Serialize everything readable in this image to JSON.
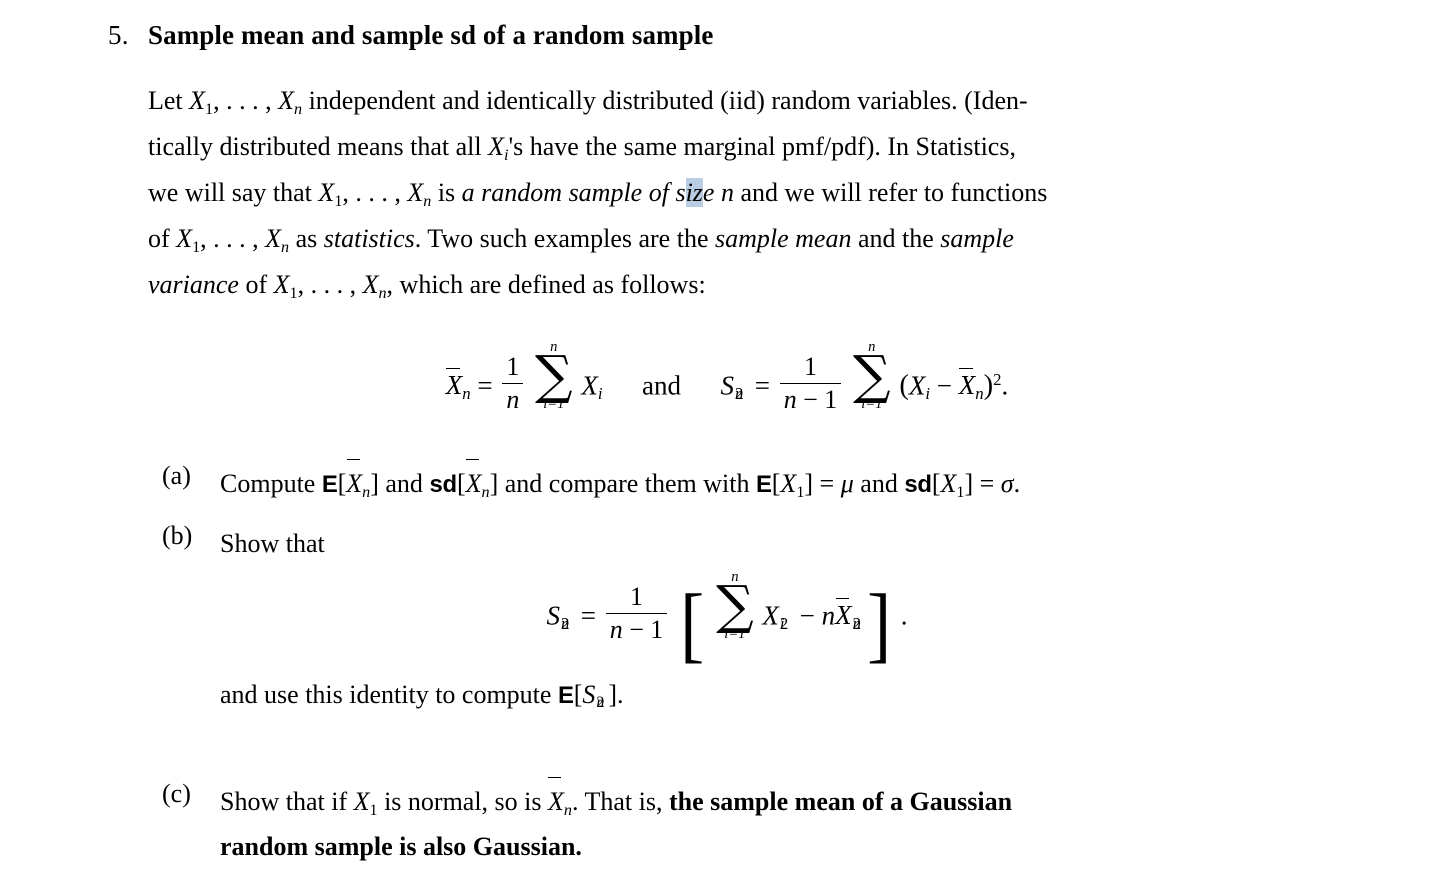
{
  "document": {
    "item_number": "5.",
    "title": "Sample mean and sample sd of a random sample",
    "paragraph": {
      "line1_a": "Let ",
      "line1_b": "X",
      "line1_c": "1",
      "line1_d": ", . . . , ",
      "line1_e": "X",
      "line1_f": "n",
      "line1_g": " independent and identically distributed (iid) random variables. (Iden-",
      "line2_a": "tically distributed means that all ",
      "line2_b": "X",
      "line2_c": "i",
      "line2_d": "'s have the same marginal pmf/pdf). In Statistics,",
      "line3_a": "we will say that ",
      "line3_b": "X",
      "line3_c": "1",
      "line3_d": ", . . . , ",
      "line3_e": "X",
      "line3_f": "n",
      "line3_g": " is ",
      "line3_h": "a random sample of s",
      "line3_highlight": "iz",
      "line3_i": "e ",
      "line3_j": "n",
      "line3_k": " and we will refer to functions",
      "line4_a": "of ",
      "line4_b": "X",
      "line4_c": "1",
      "line4_d": ", . . . , ",
      "line4_e": "X",
      "line4_f": "n",
      "line4_g": " as ",
      "line4_h": "statistics",
      "line4_i": ". Two such examples are the ",
      "line4_j": "sample mean",
      "line4_k": " and the ",
      "line4_l": "sample",
      "line5_a": "variance",
      "line5_b": " of ",
      "line5_c": "X",
      "line5_d": "1",
      "line5_e": ", . . . , ",
      "line5_f": "X",
      "line5_g": "n",
      "line5_h": ", which are defined as follows:"
    },
    "equation_main": {
      "lhs_var": "X",
      "lhs_sub": "n",
      "equals": "=",
      "frac1_num": "1",
      "frac1_den": "n",
      "sigma": "∑",
      "sum_top": "n",
      "sum_bot": "i=1",
      "summand_var": "X",
      "summand_sub": "i",
      "conjunction": "and",
      "rhs_var": "S",
      "rhs_sup": "2",
      "rhs_sub": "n",
      "frac2_num": "1",
      "frac2_den_n": "n",
      "frac2_den_minus": "−",
      "frac2_den_one": "1",
      "paren_open": "(",
      "term1_var": "X",
      "term1_sub": "i",
      "minus": "−",
      "term2_var": "X",
      "term2_sub": "n",
      "paren_close": ")",
      "power": "2",
      "period": "."
    },
    "parts": [
      {
        "label": "(a)",
        "text_a": "Compute ",
        "op1": "E",
        "b1_open": "[",
        "b1_var": "X",
        "b1_sub": "n",
        "b1_close": "]",
        "text_b": " and ",
        "op2": "sd",
        "b2_open": "[",
        "b2_var": "X",
        "b2_sub": "n",
        "b2_close": "]",
        "text_c": " and compare them with ",
        "op3": "E",
        "b3_open": "[",
        "b3_var": "X",
        "b3_sub": "1",
        "b3_close": "]",
        "eq1": " = ",
        "mu": "μ",
        "text_d": " and ",
        "op4": "sd",
        "b4_open": "[",
        "b4_var": "X",
        "b4_sub": "1",
        "b4_close": "]",
        "eq2": " = ",
        "sigma_sym": "σ",
        "period": "."
      },
      {
        "label": "(b)",
        "text_a": "Show that",
        "closing_a": "and use this identity to compute ",
        "closing_op": "E",
        "closing_open": "[",
        "closing_var": "S",
        "closing_sup": "2",
        "closing_sub": "n",
        "closing_close": "]",
        "closing_period": "."
      },
      {
        "label": "(c)",
        "text_a": "Show that if ",
        "var1": "X",
        "var1_sub": "1",
        "text_b": " is normal, so is ",
        "var2": "X",
        "var2_sub": "n",
        "text_c": ". That is,  ",
        "bold_line1": "the sample mean of a Gaussian",
        "bold_line2": "random sample is also Gaussian."
      }
    ],
    "equation_b": {
      "lhs_var": "S",
      "lhs_sup": "2",
      "lhs_sub": "n",
      "equals": "=",
      "frac_num": "1",
      "frac_den_n": "n",
      "frac_den_minus": "−",
      "frac_den_one": "1",
      "bracket_open": "[",
      "sigma": "∑",
      "sum_top": "n",
      "sum_bot": "i=1",
      "term1_var": "X",
      "term1_sub": "i",
      "term1_sup": "2",
      "minus": "−",
      "coef": "n",
      "term2_var": "X",
      "term2_sub": "n",
      "term2_sup": "2",
      "bracket_close": "]",
      "period": "."
    }
  },
  "colors": {
    "text": "#000000",
    "background": "#ffffff",
    "selection_highlight": "#b9cde5"
  }
}
